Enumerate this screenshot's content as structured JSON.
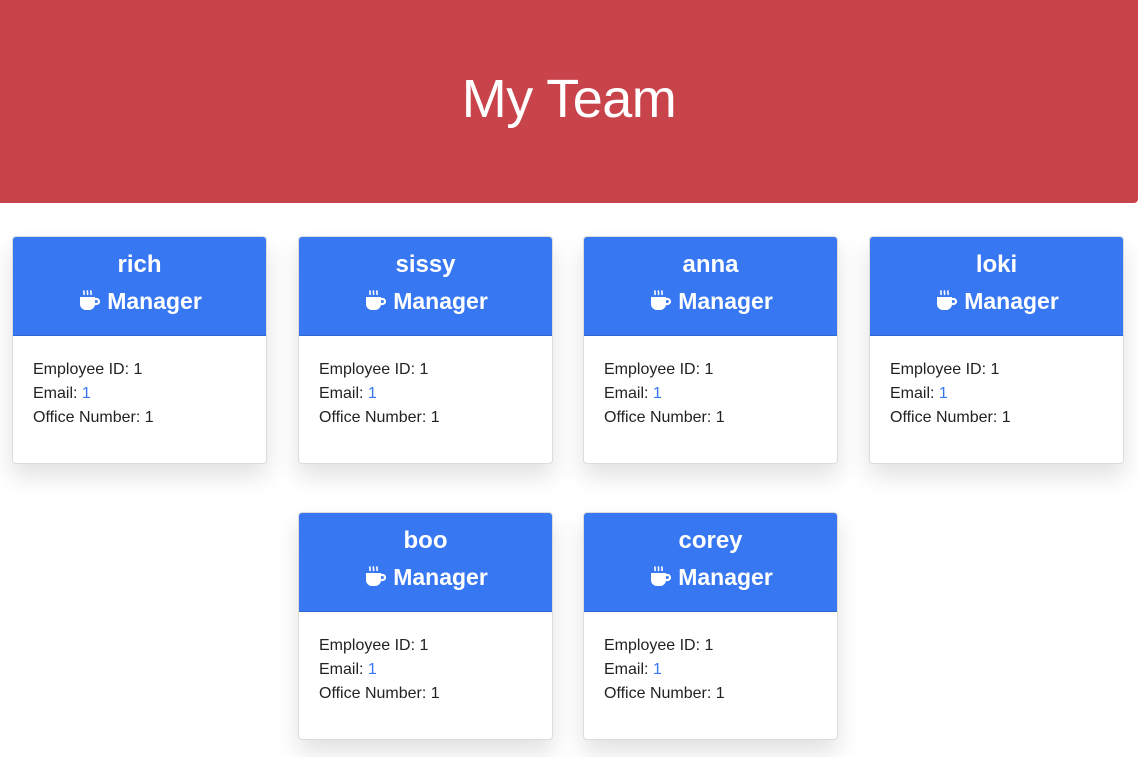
{
  "header": {
    "title": "My Team"
  },
  "labels": {
    "employee_id": "Employee ID:",
    "email": "Email:",
    "office_number": "Office Number:"
  },
  "cards": [
    {
      "name": "rich",
      "role": "Manager",
      "id": "1",
      "email": "1",
      "office": "1"
    },
    {
      "name": "sissy",
      "role": "Manager",
      "id": "1",
      "email": "1",
      "office": "1"
    },
    {
      "name": "anna",
      "role": "Manager",
      "id": "1",
      "email": "1",
      "office": "1"
    },
    {
      "name": "loki",
      "role": "Manager",
      "id": "1",
      "email": "1",
      "office": "1"
    },
    {
      "name": "boo",
      "role": "Manager",
      "id": "1",
      "email": "1",
      "office": "1"
    },
    {
      "name": "corey",
      "role": "Manager",
      "id": "1",
      "email": "1",
      "office": "1"
    }
  ],
  "icons": {
    "role": "coffee-cup-icon"
  },
  "colors": {
    "header_bg": "#c9434a",
    "card_head_bg": "#3777f2",
    "link": "#3777f2"
  }
}
